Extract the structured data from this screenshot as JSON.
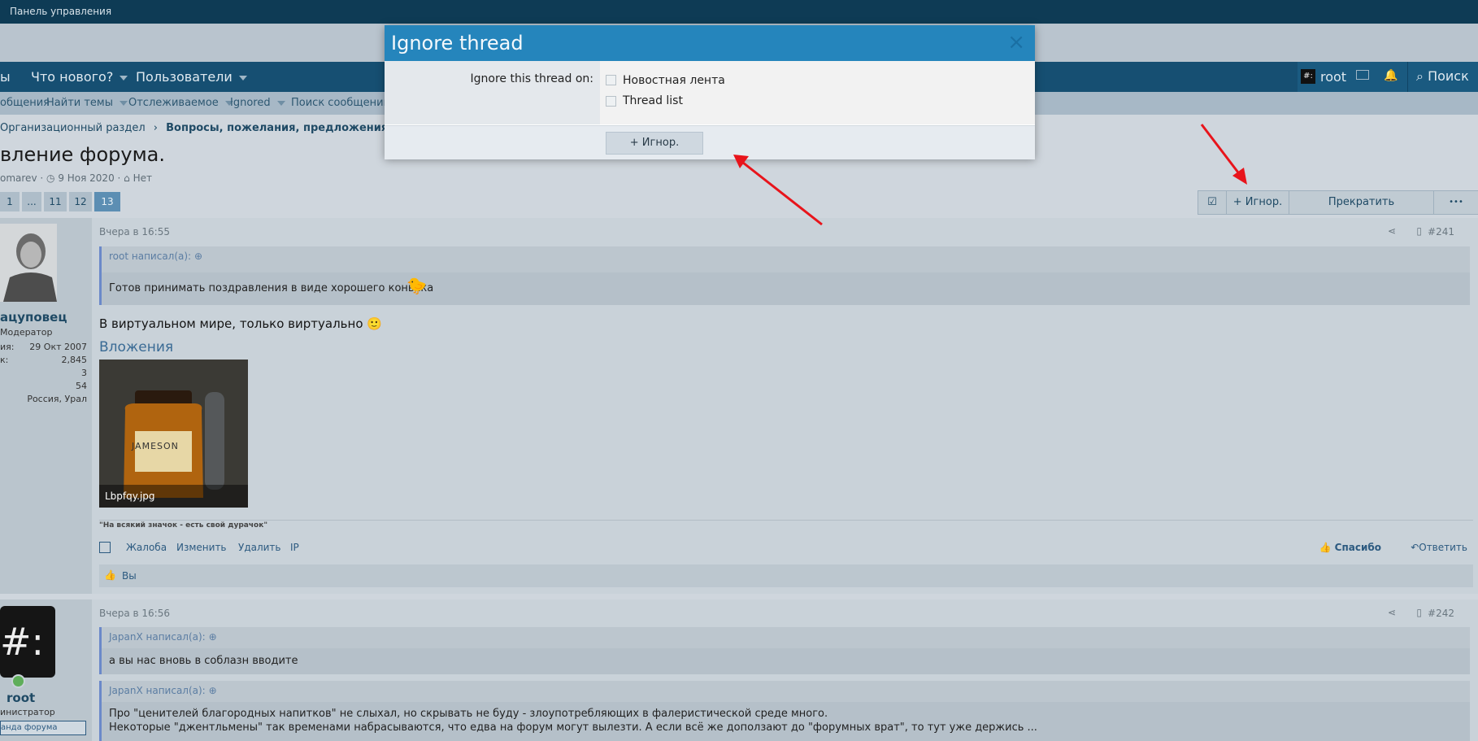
{
  "topbar": {
    "title": "Панель управления"
  },
  "nav": {
    "left_fragment": "ы",
    "whats_new": "Что нового?",
    "users": "Пользователи",
    "account_name": "root",
    "search": "Поиск"
  },
  "subnav": {
    "items": [
      "общения",
      "Найти темы",
      "Отслеживаемое",
      "Ignored",
      "Поиск сообщений"
    ]
  },
  "breadcrumb": {
    "item1": "Организационный раздел",
    "item2": "Вопросы, пожелания, предложения."
  },
  "thread": {
    "title": "вление форума.",
    "author": "omarev",
    "date": "9 Ноя 2020",
    "tags": "Нет"
  },
  "pagination": {
    "pages": [
      "1",
      "...",
      "11",
      "12",
      "13"
    ],
    "current": "13"
  },
  "thread_actions": {
    "ignore": "+ Игнор.",
    "unwatch": "Прекратить отслеживание",
    "more": "•••"
  },
  "post1": {
    "time": "Вчера в 16:55",
    "number": "#241",
    "user": {
      "name": "ацуповец",
      "role": "Модератор",
      "labels": [
        "ия:",
        "к:",
        "",
        ""
      ],
      "values": [
        "29 Окт 2007",
        "2,845",
        "3",
        "54"
      ],
      "location": "Россия, Урал"
    },
    "quote_author": "root написал(а):",
    "quote_text": "Готов принимать поздравления в виде хорошего коньяка",
    "body": "В виртуальном мире, только виртуально",
    "attachments_heading": "Вложения",
    "attachment_name": "Lbpfqy.jpg",
    "bottle_label": "JAMESON",
    "signature": "\"На всякий значок - есть свой дурачок\"",
    "actions": [
      "Жалоба",
      "Изменить",
      "Удалить",
      "IP"
    ],
    "like": "Спасибо",
    "reply": "Ответить",
    "reactions": "Вы"
  },
  "post2": {
    "time": "Вчера в 16:56",
    "number": "#242",
    "user": {
      "avatar_text": "#:",
      "name": "root",
      "role": "инистратор",
      "banner": "анда форума"
    },
    "quote1_author": "JapanX написал(а):",
    "quote1_text": "а вы нас вновь в соблазн вводите",
    "quote2_author": "JapanX написал(а):",
    "quote2_line1": "Про \"ценителей благородных напитков\" не слыхал, но скрывать не буду - злоупотребляющих в фалеристической среде много.",
    "quote2_line2": "Некоторые \"джентльмены\" так временами набрасываются, что едва на форум могут вылезти. А если всё же доползают до \"форумных врат\", то тут уже держись ..."
  },
  "modal": {
    "title": "Ignore thread",
    "label": "Ignore this thread on:",
    "option1": "Новостная лента",
    "option2": "Thread list",
    "submit": "+ Игнор."
  },
  "annotation_color": "#e8141b"
}
